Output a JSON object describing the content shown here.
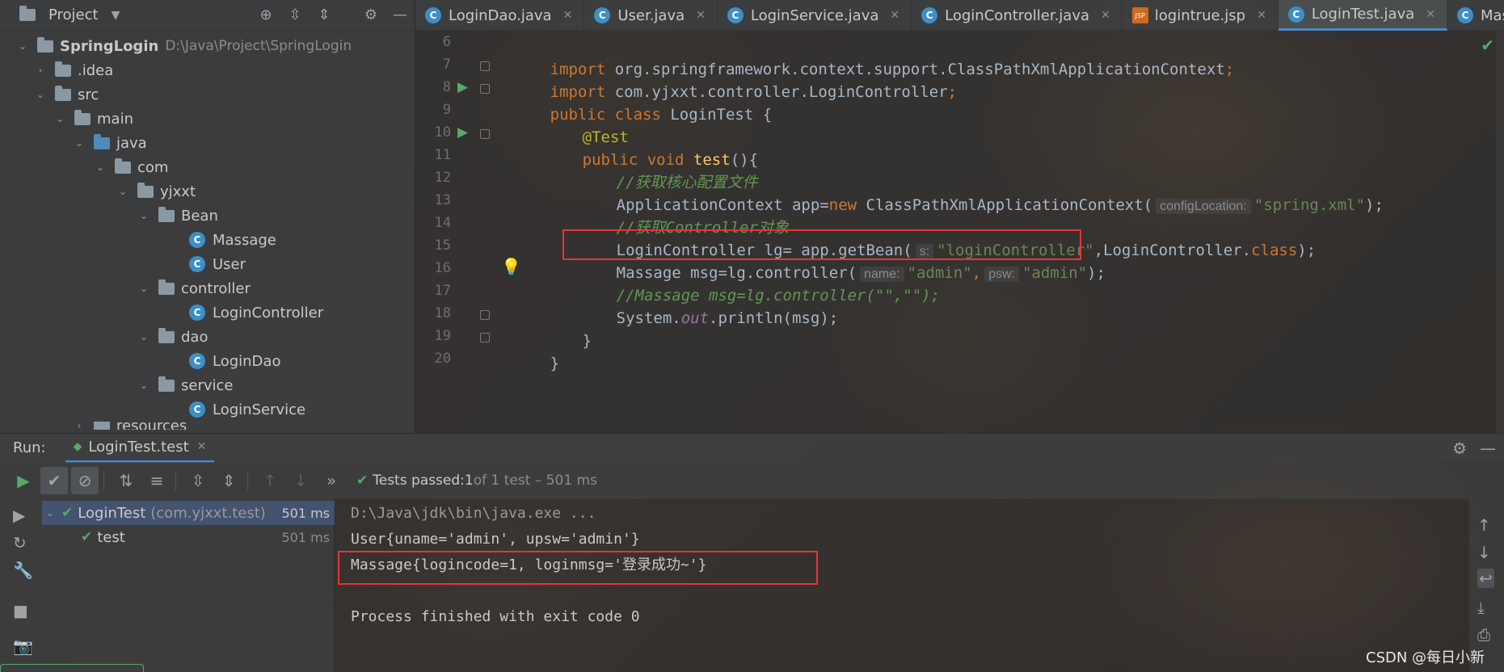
{
  "project": {
    "title": "Project",
    "tree": [
      {
        "label": "SpringLogin",
        "hint": "D:\\Java\\Project\\SpringLogin"
      },
      {
        "label": ".idea"
      },
      {
        "label": "src"
      },
      {
        "label": "main"
      },
      {
        "label": "java"
      },
      {
        "label": "com"
      },
      {
        "label": "yjxxt"
      },
      {
        "label": "Bean"
      },
      {
        "label": "Massage"
      },
      {
        "label": "User"
      },
      {
        "label": "controller"
      },
      {
        "label": "LoginController"
      },
      {
        "label": "dao"
      },
      {
        "label": "LoginDao"
      },
      {
        "label": "service"
      },
      {
        "label": "LoginService"
      },
      {
        "label": "resources"
      }
    ]
  },
  "tabs": [
    {
      "label": "LoginDao.java",
      "icon": "class-icon"
    },
    {
      "label": "User.java",
      "icon": "class-icon"
    },
    {
      "label": "LoginService.java",
      "icon": "class-icon"
    },
    {
      "label": "LoginController.java",
      "icon": "class-icon"
    },
    {
      "label": "logintrue.jsp",
      "icon": "jsp-icon"
    },
    {
      "label": "LoginTest.java",
      "icon": "test-class-icon",
      "active": true
    },
    {
      "label": "Massag",
      "icon": "class-icon"
    }
  ],
  "editor": {
    "line_numbers": [
      "6",
      "7",
      "8",
      "9",
      "10",
      "11",
      "12",
      "13",
      "14",
      "15",
      "16",
      "17",
      "18",
      "19",
      "20"
    ],
    "code": {
      "l6a": "import ",
      "l6b": "org.springframework.context.support.ClassPathXmlApplicationContext",
      "l6c": ";",
      "l7a": "import ",
      "l7b": "com.yjxxt.controller.LoginController",
      "l7c": ";",
      "l8a": "public class ",
      "l8b": "LoginTest {",
      "l9": "@Test",
      "l10a": "public void ",
      "l10b": "test",
      "l10c": "(){",
      "l11": "//获取核心配置文件",
      "l12a": "ApplicationContext app=",
      "l12b": "new ",
      "l12c": "ClassPathXmlApplicationContext(",
      "l12hint": "configLocation:",
      "l12d": "\"spring.xml\"",
      "l12e": ");",
      "l13a": "//获取",
      "l13b": "Controller",
      "l13c": "对象",
      "l14a": "LoginController lg= app.getBean(",
      "l14hint": "s:",
      "l14b": "\"loginController\"",
      "l14c": ",LoginController.",
      "l14d": "class",
      "l14e": ");",
      "l15a": "Massage msg=lg.controller(",
      "l15hint1": "name:",
      "l15b": "\"admin\"",
      "l15c": ",",
      "l15hint2": "psw:",
      "l15d": "\"admin\"",
      "l15e": ");",
      "l16": "//Massage msg=lg.controller(\"\",\"\");",
      "l17a": "System.",
      "l17b": "out",
      "l17c": ".println(msg);",
      "l18": "}",
      "l19": "}"
    }
  },
  "run": {
    "label": "Run:",
    "tab": "LoginTest.test",
    "status_prefix": "Tests passed: ",
    "status_count": "1",
    "status_suffix": " of 1 test – 501 ms",
    "tests": [
      {
        "name": "LoginTest",
        "pkg": "(com.yjxxt.test)",
        "time": "501 ms"
      },
      {
        "name": "test",
        "time": "501 ms"
      }
    ],
    "console": [
      "D:\\Java\\jdk\\bin\\java.exe ...",
      "User{uname='admin', upsw='admin'}",
      "Massage{logincode=1, loginmsg='登录成功~'}",
      "",
      "Process finished with exit code 0"
    ]
  },
  "watermark": "CSDN @每日小新",
  "colors": {
    "keyword": "#cc7832",
    "string": "#6a8759",
    "comment": "#629755",
    "annotation": "#bbb529",
    "method": "#ffc66d",
    "success": "#59a869",
    "highlight_box": "#e53535",
    "accent": "#4a88c7"
  }
}
